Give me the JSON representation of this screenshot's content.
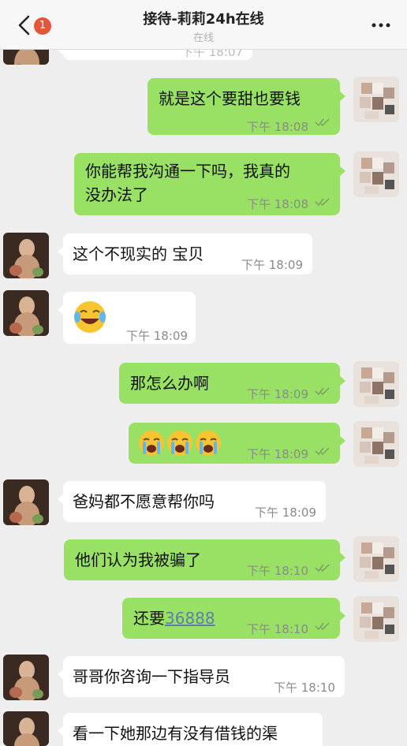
{
  "header": {
    "title": "接待-莉莉24h在线",
    "subtitle": "在线",
    "badge": "1"
  },
  "colors": {
    "outgoing_bubble": "#98e165",
    "incoming_bubble": "#ffffff",
    "badge": "#e4553c",
    "background": "#eeeeee"
  },
  "messages": [
    {
      "side": "in",
      "text": "",
      "time": "下午 18:07"
    },
    {
      "side": "out",
      "text": "就是这个要甜也要钱",
      "time": "下午 18:08"
    },
    {
      "side": "out",
      "line1": "你能帮我沟通一下吗，我真的",
      "line2": "没办法了",
      "time": "下午 18:08"
    },
    {
      "side": "in",
      "text": "这个不现实的 宝贝",
      "time": "下午 18:09"
    },
    {
      "side": "in",
      "emoji": "laugh-cry-emoji",
      "time": "下午 18:09"
    },
    {
      "side": "out",
      "text": "那怎么办啊",
      "time": "下午 18:09"
    },
    {
      "side": "out",
      "emoji": "crying-emoji x3",
      "time": "下午 18:09"
    },
    {
      "side": "in",
      "text": "爸妈都不愿意帮你吗",
      "time": "下午 18:09"
    },
    {
      "side": "out",
      "text": "他们认为我被骗了",
      "time": "下午 18:10"
    },
    {
      "side": "out",
      "prefix": "还要",
      "link": "36888",
      "time": "下午 18:10"
    },
    {
      "side": "in",
      "text": "哥哥你咨询一下指导员",
      "time": "下午 18:10"
    },
    {
      "side": "in",
      "text": "看一下她那边有没有借钱的渠",
      "time": ""
    }
  ]
}
